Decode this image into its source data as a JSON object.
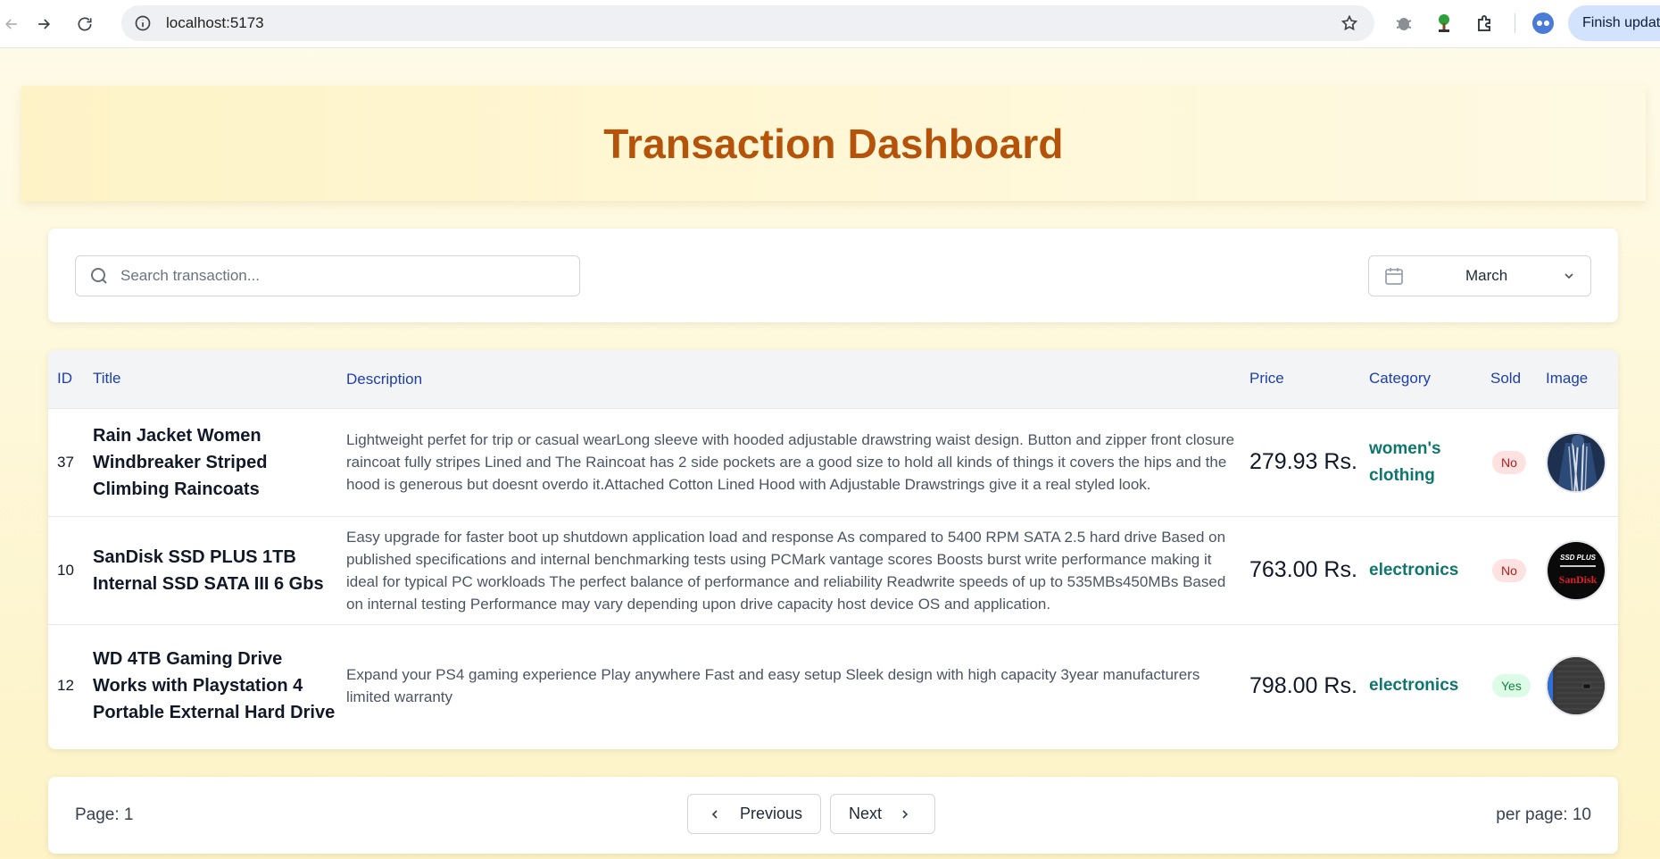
{
  "browser": {
    "url": "localhost:5173",
    "update_label": "Finish update"
  },
  "header": {
    "title": "Transaction Dashboard"
  },
  "filters": {
    "search_placeholder": "Search transaction...",
    "month": "March"
  },
  "table": {
    "headers": {
      "id": "ID",
      "title": "Title",
      "description": "Description",
      "price": "Price",
      "category": "Category",
      "sold": "Sold",
      "image": "Image"
    },
    "rows": [
      {
        "id": "37",
        "title": "Rain Jacket Women Windbreaker Striped Climbing Raincoats",
        "description": "Lightweight perfet for trip or casual wearLong sleeve with hooded adjustable drawstring waist design. Button and zipper front closure raincoat fully stripes Lined and The Raincoat has 2 side pockets are a good size to hold all kinds of things it covers the hips and the hood is generous but doesnt overdo it.Attached Cotton Lined Hood with Adjustable Drawstrings give it a real styled look.",
        "price": "279.93 Rs.",
        "category": "women's clothing",
        "sold": "No",
        "image_label": "striped rain jacket"
      },
      {
        "id": "10",
        "title": "SanDisk SSD PLUS 1TB Internal SSD SATA III 6 Gbs",
        "description": "Easy upgrade for faster boot up shutdown application load and response As compared to 5400 RPM SATA 2.5 hard drive Based on published specifications and internal benchmarking tests using PCMark vantage scores Boosts burst write performance making it ideal for typical PC workloads The perfect balance of performance and reliability Readwrite speeds of up to 535MBs450MBs Based on internal testing Performance may vary depending upon drive capacity host device OS and application.",
        "price": "763.00 Rs.",
        "category": "electronics",
        "sold": "No",
        "image_label": "SanDisk SSD PLUS",
        "image_text_top": "SSD PLUS",
        "image_text_brand": "SanDisk"
      },
      {
        "id": "12",
        "title": "WD 4TB Gaming Drive Works with Playstation 4 Portable External Hard Drive",
        "description": "Expand your PS4 gaming experience Play anywhere Fast and easy setup Sleek design with high capacity 3year manufacturers limited warranty",
        "price": "798.00 Rs.",
        "category": "electronics",
        "sold": "Yes",
        "image_label": "WD gaming drive"
      }
    ]
  },
  "pagination": {
    "page_label": "Page: 1",
    "previous_label": "Previous",
    "next_label": "Next",
    "per_page_label": "per page: 10"
  }
}
